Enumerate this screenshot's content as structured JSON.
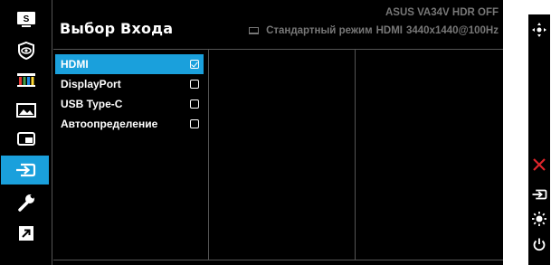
{
  "title": "Выбор Входа",
  "model": "ASUS  VA34V HDR OFF",
  "status": {
    "mode": "Стандартный режим",
    "input": "HDMI",
    "resolution": "3440x1440@100Hz"
  },
  "sidebar": {
    "items": [
      {
        "icon": "splendid-icon",
        "label": "S"
      },
      {
        "icon": "eye-care-icon"
      },
      {
        "icon": "color-icon"
      },
      {
        "icon": "image-icon"
      },
      {
        "icon": "pip-icon"
      },
      {
        "icon": "input-select-icon",
        "active": true
      },
      {
        "icon": "system-setup-icon"
      },
      {
        "icon": "shortcut-icon"
      }
    ]
  },
  "inputs": [
    {
      "label": "HDMI",
      "selected": true
    },
    {
      "label": "DisplayPort",
      "selected": false
    },
    {
      "label": "USB Type-C",
      "selected": false
    },
    {
      "label": "Автоопределение",
      "selected": false
    }
  ],
  "keys": [
    "joystick-icon",
    "close-icon",
    "input-icon",
    "brightness-icon",
    "power-icon"
  ],
  "colors": {
    "accent": "#1aa0dc",
    "background": "#000000",
    "text": "#ffffff",
    "muted": "#777777",
    "close": "#e0252b"
  }
}
